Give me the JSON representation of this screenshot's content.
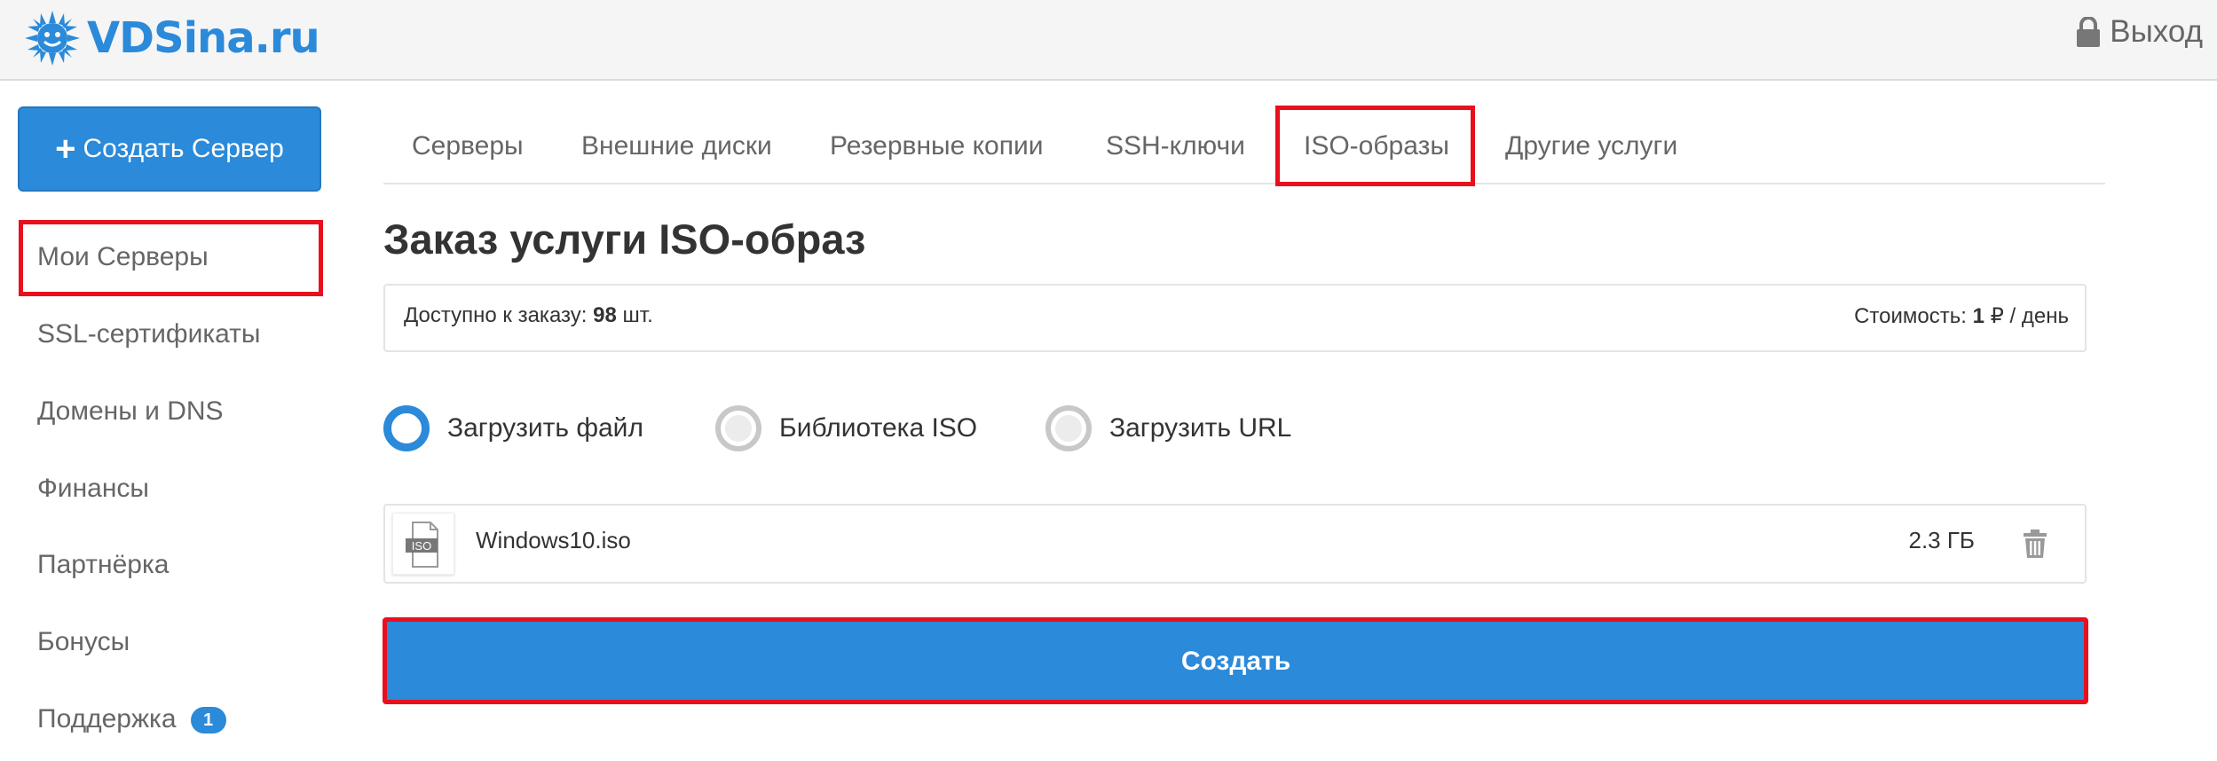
{
  "header": {
    "logo_text": "VDSina.ru",
    "logout_label": "Выход"
  },
  "sidebar": {
    "create_button_label": "Создать Сервер",
    "items": [
      {
        "label": "Мои Серверы"
      },
      {
        "label": "SSL-сертификаты"
      },
      {
        "label": "Домены и DNS"
      },
      {
        "label": "Финансы"
      },
      {
        "label": "Партнёрка"
      },
      {
        "label": "Бонусы"
      },
      {
        "label": "Поддержка",
        "badge": "1"
      }
    ]
  },
  "tabs": [
    {
      "label": "Серверы"
    },
    {
      "label": "Внешние диски"
    },
    {
      "label": "Резервные копии"
    },
    {
      "label": "SSH-ключи"
    },
    {
      "label": "ISO-образы"
    },
    {
      "label": "Другие услуги"
    }
  ],
  "main": {
    "title": "Заказ услуги ISO-образ",
    "available_prefix": "Доступно к заказу:",
    "available_count": "98",
    "available_unit": "шт.",
    "cost_prefix": "Стоимость:",
    "cost_value": "1",
    "cost_unit": "₽ / день",
    "radio_options": [
      {
        "label": "Загрузить файл",
        "checked": true
      },
      {
        "label": "Библиотека ISO",
        "checked": false
      },
      {
        "label": "Загрузить URL",
        "checked": false
      }
    ],
    "file": {
      "icon_text": "ISO",
      "name": "Windows10.iso",
      "size": "2.3 ГБ"
    },
    "submit_label": "Создать"
  },
  "colors": {
    "accent": "#2b8ad9",
    "highlight": "#e8101e"
  }
}
